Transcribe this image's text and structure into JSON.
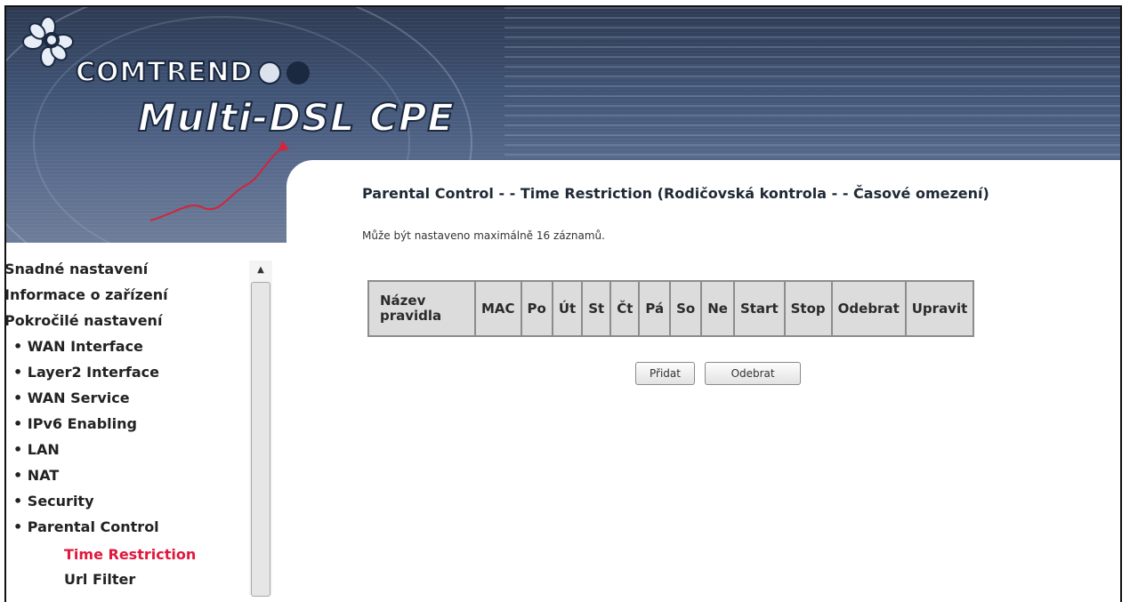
{
  "header": {
    "brand": "COMTREND",
    "product": "Multi-DSL CPE",
    "colors": {
      "banner_dark": "#2d3a52",
      "banner_light": "#6d7d99",
      "accent_red": "#e0183c"
    }
  },
  "sidebar": {
    "items": [
      {
        "label": "Snadné nastavení"
      },
      {
        "label": "Informace o zařízení"
      },
      {
        "label": "Pokročilé nastavení"
      },
      {
        "label": "• WAN Interface"
      },
      {
        "label": "• Layer2 Interface"
      },
      {
        "label": "• WAN Service"
      },
      {
        "label": "• IPv6 Enabling"
      },
      {
        "label": "• LAN"
      },
      {
        "label": "• NAT"
      },
      {
        "label": "• Security"
      },
      {
        "label": "• Parental Control"
      },
      {
        "label": "Time Restriction"
      },
      {
        "label": "Url Filter"
      }
    ],
    "scroll_up_icon": "▲"
  },
  "main": {
    "title": "Parental Control - - Time Restriction (Rodičovská kontrola - - Časové omezení)",
    "note": "Může být nastaveno maximálně 16 záznamů.",
    "table": {
      "headers": [
        "Název pravidla",
        "MAC",
        "Po",
        "Út",
        "St",
        "Čt",
        "Pá",
        "So",
        "Ne",
        "Start",
        "Stop",
        "Odebrat",
        "Upravit"
      ]
    },
    "buttons": {
      "add": "Přidat",
      "remove": "Odebrat"
    }
  }
}
